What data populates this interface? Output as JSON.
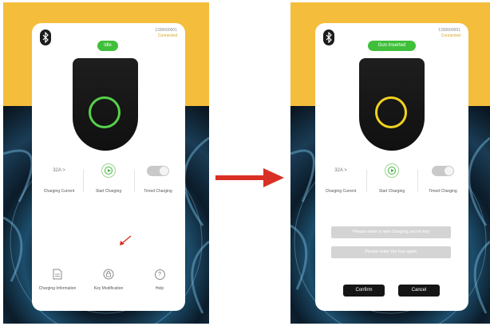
{
  "left_screen": {
    "device_id": "1330600001",
    "device_state": "Connected",
    "status_badge": "Idle",
    "charging_current": "32A",
    "charging_current_caret": ">",
    "labels": {
      "charging_current": "Charging Current",
      "start_charging": "Start Charging",
      "timed_charging": "Timed Charging"
    },
    "bottom": {
      "charging_information": "Charging Information",
      "key_modification": "Key Modification",
      "help": "Help"
    }
  },
  "right_screen": {
    "device_id": "1330600001",
    "device_state": "Connected",
    "status_badge": "Gun Inserted",
    "charging_current": "32A",
    "charging_current_caret": ">",
    "labels": {
      "charging_current": "Charging Current",
      "start_charging": "Start Charging",
      "timed_charging": "Timed Charging"
    },
    "form": {
      "new_key_placeholder": "Please enter a new charging secret key",
      "confirm_key_placeholder": "Please enter the key again"
    },
    "buttons": {
      "confirm": "Confirm",
      "cancel": "Cancel"
    }
  },
  "colors": {
    "accent_green": "#3fbf3a",
    "ring_idle": "#55d24a",
    "ring_inserted": "#f2d21e",
    "arrow_red": "#d93025",
    "background_top": "#f4bd3c"
  },
  "icons": {
    "bluetooth": "bluetooth-icon",
    "play": "play-icon",
    "document": "document-icon",
    "lock": "lock-icon",
    "help": "question-icon",
    "arrow": "arrow-right-icon"
  }
}
